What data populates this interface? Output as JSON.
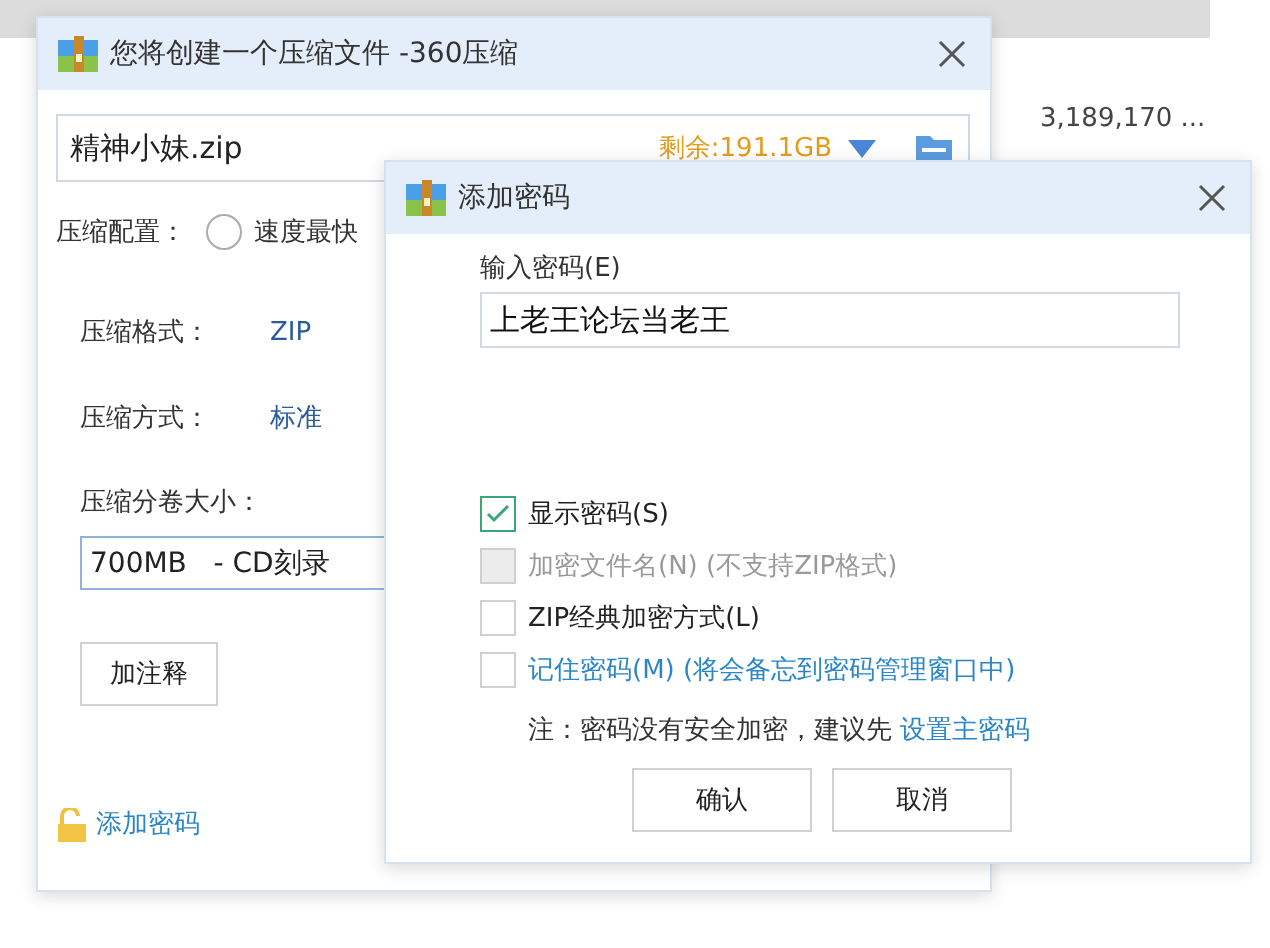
{
  "background": {
    "size_text": "3,189,170 ..."
  },
  "main_window": {
    "title": "您将创建一个压缩文件 -360压缩",
    "file_name": "精神小妹.zip",
    "free_space": "剩余:191.1GB",
    "config_label": "压缩配置：",
    "config_options": [
      {
        "label": "速度最快",
        "selected": false
      }
    ],
    "settings": [
      {
        "label": "压缩格式：",
        "value": "ZIP"
      },
      {
        "label": "压缩方式：",
        "value": "标准"
      }
    ],
    "split_label": "压缩分卷大小：",
    "split_value": "700MB   - CD刻录",
    "comment_button": "加注释",
    "password_link": "添加密码"
  },
  "password_dialog": {
    "title": "添加密码",
    "password_label": "输入密码(E)",
    "password_value": "上老王论坛当老王",
    "options": [
      {
        "label": "显示密码(S)",
        "checked": true,
        "disabled": false,
        "kind": "plain"
      },
      {
        "label": "加密文件名(N) (不支持ZIP格式)",
        "checked": false,
        "disabled": true,
        "kind": "plain"
      },
      {
        "label": "ZIP经典加密方式(L)",
        "checked": false,
        "disabled": false,
        "kind": "plain"
      },
      {
        "label": "记住密码(M) (将会备忘到密码管理窗口中)",
        "checked": false,
        "disabled": false,
        "kind": "link"
      }
    ],
    "note": "注：密码没有安全加密，建议先",
    "note_link": "设置主密码",
    "buttons": [
      "确认",
      "取消"
    ]
  }
}
